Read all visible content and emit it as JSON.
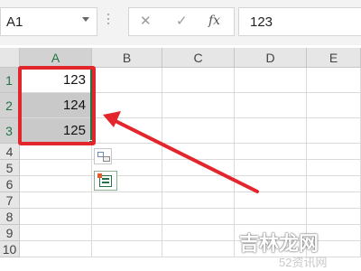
{
  "formula_bar": {
    "name_box": "A1",
    "cancel_glyph": "✕",
    "enter_glyph": "✓",
    "fx_label": "fx",
    "value": "123"
  },
  "columns": [
    "A",
    "B",
    "C",
    "D",
    "E"
  ],
  "rows": [
    "1",
    "2",
    "3",
    "4",
    "5",
    "6",
    "7",
    "8",
    "9",
    "10"
  ],
  "cells": {
    "A1": "123",
    "A2": "124",
    "A3": "125"
  },
  "icons": {
    "autofill_options": "autofill-options-icon",
    "quick_analysis": "quick-analysis-icon"
  },
  "annotation": {
    "highlight_color": "#e3252c",
    "arrow_color": "#e3252c"
  },
  "watermark": {
    "logo_text": "吉林龙网",
    "url_text": "52资讯网"
  },
  "theme": {
    "accent": "#217346",
    "selected_fill": "#c9c9c9"
  }
}
